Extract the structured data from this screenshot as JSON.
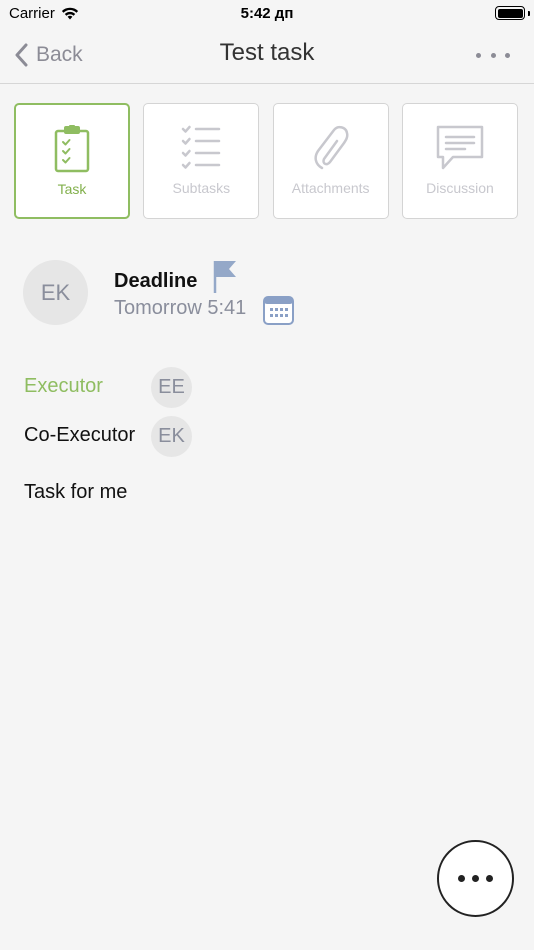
{
  "status_bar": {
    "carrier": "Carrier",
    "time": "5:42 дп",
    "battery_level": 1.0
  },
  "nav": {
    "back_label": "Back",
    "title": "Test task",
    "more_icon": "more-horizontal-icon"
  },
  "tabs": [
    {
      "label": "Task",
      "icon": "clipboard-checklist-icon",
      "active": true
    },
    {
      "label": "Subtasks",
      "icon": "checklist-icon",
      "active": false
    },
    {
      "label": "Attachments",
      "icon": "paperclip-icon",
      "active": false
    },
    {
      "label": "Discussion",
      "icon": "chat-bubble-icon",
      "active": false
    }
  ],
  "deadline": {
    "avatar_initials": "EK",
    "label": "Deadline",
    "value": "Tomorrow 5:41",
    "flag_icon": "flag-icon",
    "calendar_icon": "calendar-icon"
  },
  "people": {
    "executor_label": "Executor",
    "executor_initials": "EE",
    "coexecutor_label": "Co-Executor",
    "coexecutor_initials": "EK"
  },
  "description": "Task for me",
  "colors": {
    "accent_green": "#8fbd61",
    "inactive_gray": "#c8c8ce",
    "secondary_text": "#8a8e9c",
    "flag_blue": "#94a8c8"
  }
}
